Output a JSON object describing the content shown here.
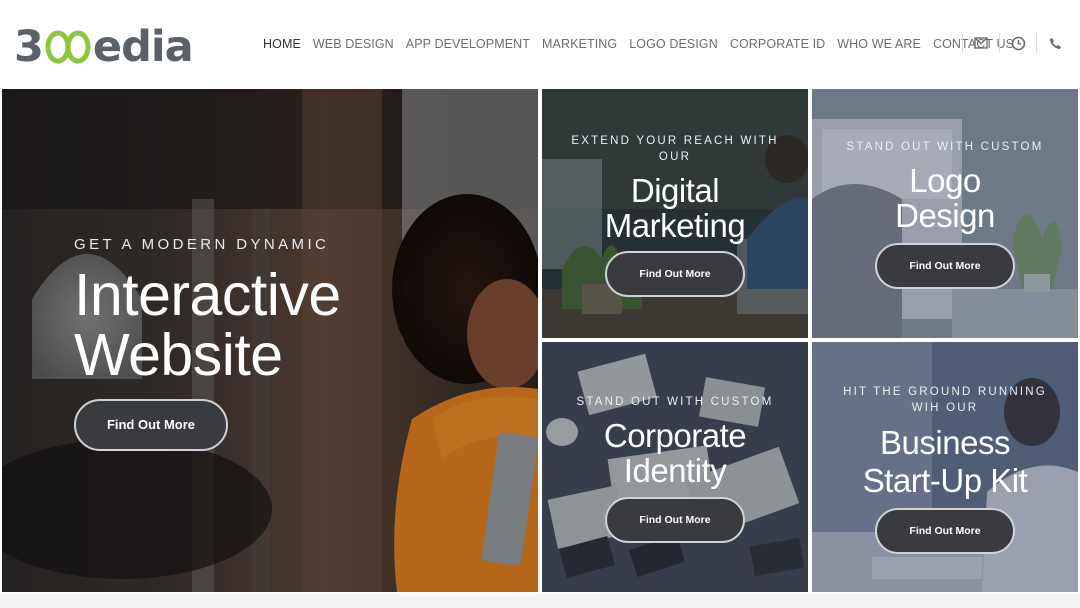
{
  "brand": {
    "logo_text_prefix": "3",
    "logo_text_suffix": "edia",
    "accent_color": "#8dc63f"
  },
  "nav": {
    "items": [
      {
        "label": "HOME",
        "active": true
      },
      {
        "label": "WEB DESIGN"
      },
      {
        "label": "APP DEVELOPMENT"
      },
      {
        "label": "MARKETING"
      },
      {
        "label": "LOGO DESIGN"
      },
      {
        "label": "CORPORATE ID"
      },
      {
        "label": "WHO WE ARE"
      },
      {
        "label": "CONTACT US"
      }
    ],
    "icons": [
      "envelope-icon",
      "clock-icon",
      "phone-icon"
    ]
  },
  "tiles": {
    "hero": {
      "eyebrow": "GET A MODERN DYNAMIC",
      "headline_line1": "Interactive",
      "headline_line2": "Website",
      "button": "Find Out More"
    },
    "marketing": {
      "eyebrow_line1": "EXTEND YOUR REACH WITH",
      "eyebrow_line2": "OUR",
      "headline_line1": "Digital",
      "headline_line2": "Marketing",
      "button": "Find Out More"
    },
    "logo": {
      "eyebrow": "STAND OUT WITH CUSTOM",
      "headline_line1": "Logo",
      "headline_line2": "Design",
      "button": "Find Out More"
    },
    "identity": {
      "eyebrow": "STAND OUT WITH CUSTOM",
      "headline_line1": "Corporate",
      "headline_line2": "Identity",
      "button": "Find Out More"
    },
    "startup": {
      "eyebrow_line1": "HIT THE GROUND RUNNING",
      "eyebrow_line2": "WIH OUR",
      "headline_line1": "Business",
      "headline_line2": "Start-Up Kit",
      "button": "Find Out More"
    }
  }
}
